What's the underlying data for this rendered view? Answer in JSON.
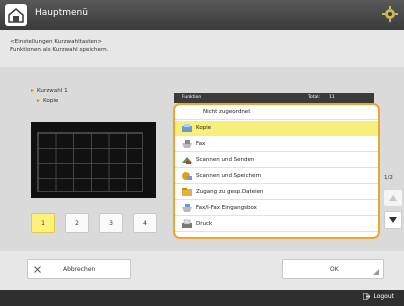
{
  "header": {
    "title": "Hauptmenü"
  },
  "instructions": [
    "<Einstellungen Kurzwahltasten>",
    "Funktionen als Kurzwahl speichern."
  ],
  "tree": {
    "parent": "Kurzwahl 1",
    "child": "Kopie"
  },
  "page_buttons": [
    "1",
    "2",
    "3",
    "4"
  ],
  "list_header": {
    "col1": "Funktion",
    "col2": "Total:",
    "col3": "11"
  },
  "list": [
    {
      "label": "Nicht zugeordnet",
      "icon": "none",
      "selected": false
    },
    {
      "label": "Kopie",
      "icon": "copy-icon",
      "selected": true
    },
    {
      "label": "Fax",
      "icon": "fax-icon",
      "selected": false
    },
    {
      "label": "Scannen und Senden",
      "icon": "scan-send-icon",
      "selected": false
    },
    {
      "label": "Scannen und Speichern",
      "icon": "scan-store-icon",
      "selected": false
    },
    {
      "label": "Zugang zu gesp.Dateien",
      "icon": "stored-files-icon",
      "selected": false
    },
    {
      "label": "Fax/I-Fax Eingangsbox",
      "icon": "fax-inbox-icon",
      "selected": false
    },
    {
      "label": "Druck",
      "icon": "print-icon",
      "selected": false
    }
  ],
  "pagination": "1/2",
  "footer": {
    "cancel": "Abbrechen",
    "ok": "OK",
    "logout": "Logout"
  },
  "colors": {
    "accent": "#f0a52a",
    "selected": "#f6f07a",
    "active_button": "#fff27a"
  }
}
